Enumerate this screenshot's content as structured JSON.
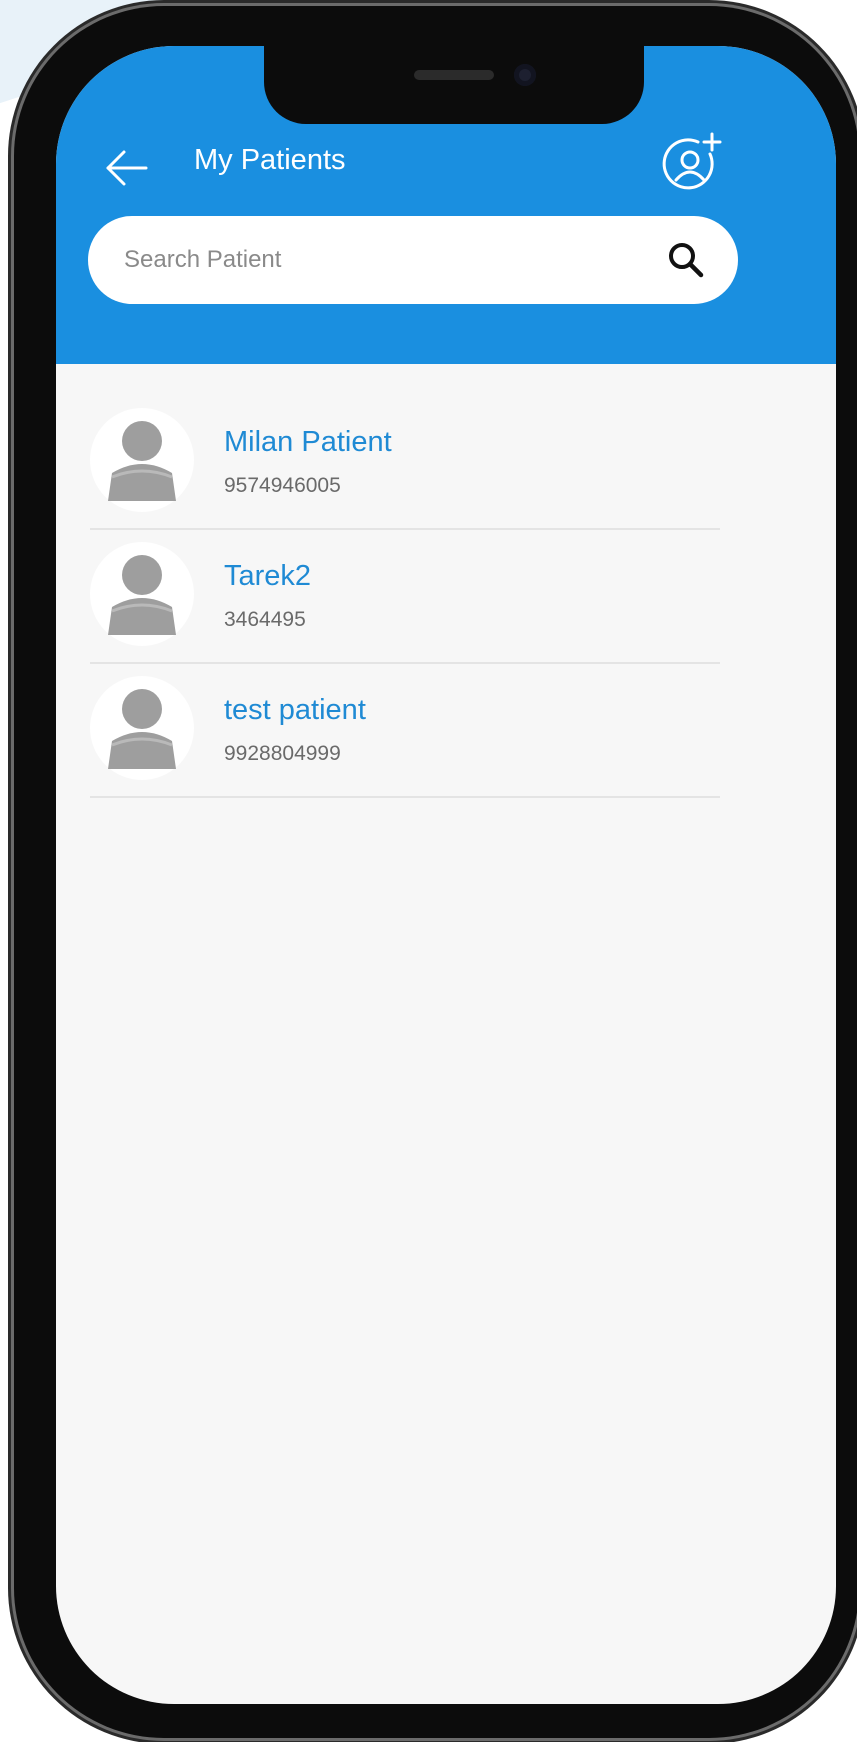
{
  "colors": {
    "header": "#1a8fe0",
    "name_text": "#1f8ad4",
    "phone_text": "#6a6a6a",
    "background": "#f7f7f7"
  },
  "header": {
    "title": "My Patients",
    "back_icon": "arrow-left-icon",
    "add_icon": "add-user-icon"
  },
  "search": {
    "placeholder": "Search Patient",
    "value": "",
    "icon": "search-icon"
  },
  "patients": [
    {
      "name": "Milan Patient",
      "phone": "9574946005"
    },
    {
      "name": "Tarek2",
      "phone": "3464495"
    },
    {
      "name": "test patient",
      "phone": "9928804999"
    }
  ]
}
